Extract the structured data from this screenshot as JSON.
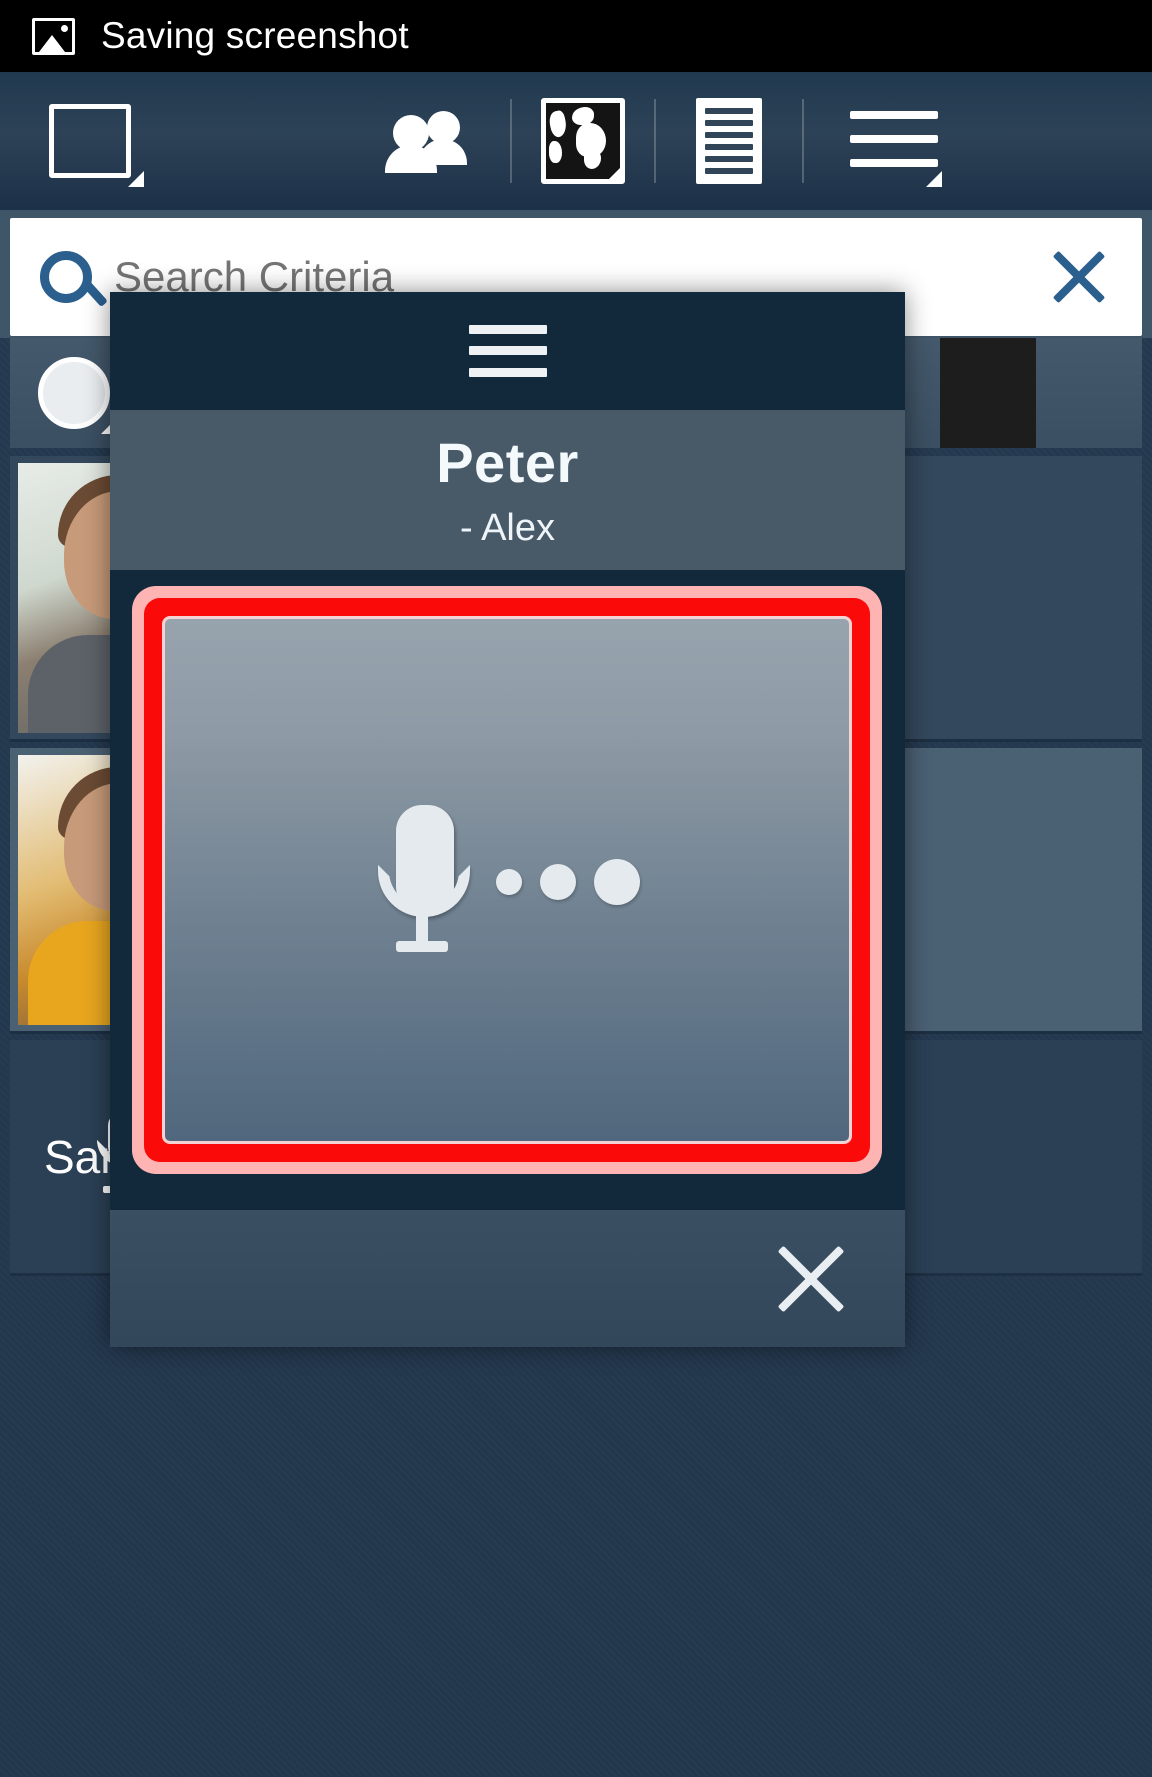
{
  "statusbar": {
    "icon": "image-icon",
    "message": "Saving screenshot"
  },
  "toolbar": {
    "items": [
      {
        "name": "screen-toggle-button",
        "icon": "square-icon",
        "label": ""
      },
      {
        "name": "contacts-button",
        "icon": "people-icon",
        "label": ""
      },
      {
        "name": "map-button",
        "icon": "world-map-icon",
        "label": ""
      },
      {
        "name": "list-button",
        "icon": "document-lines-icon",
        "label": ""
      },
      {
        "name": "menu-button",
        "icon": "hamburger-menu-icon",
        "label": ""
      }
    ]
  },
  "search": {
    "placeholder": "Search Criteria",
    "value": "",
    "search_icon": "magnifier-icon",
    "clear_icon": "close-x-icon"
  },
  "list": {
    "filter_icon": "circle-filter-icon",
    "rows": [
      {
        "name": "",
        "mic_icon": "microphone-icon",
        "mic_state": "idle"
      },
      {
        "name": "",
        "mic_icon": "microphone-icon",
        "mic_state": "recording"
      },
      {
        "name": "Sam",
        "mic_icon": "microphone-icon",
        "mic_state": "idle"
      }
    ]
  },
  "dialog": {
    "menu_icon": "hamburger-menu-icon",
    "title": "Peter",
    "subtitle": "- Alex",
    "recorder": {
      "state": "recording",
      "mic_icon": "microphone-icon",
      "dots": 3,
      "border_color": "#fb0a0a",
      "glow_color": "#ffb4b4"
    },
    "close_icon": "close-x-icon"
  },
  "colors": {
    "statusbar_bg": "#000000",
    "toolbar_bg": "#2d4257",
    "search_bg": "#ffffff",
    "dialog_header_bg": "#12293b",
    "dialog_title_bg": "#485968",
    "accent_red": "#fb0a0a",
    "accent_blue": "#2b5f8e"
  }
}
